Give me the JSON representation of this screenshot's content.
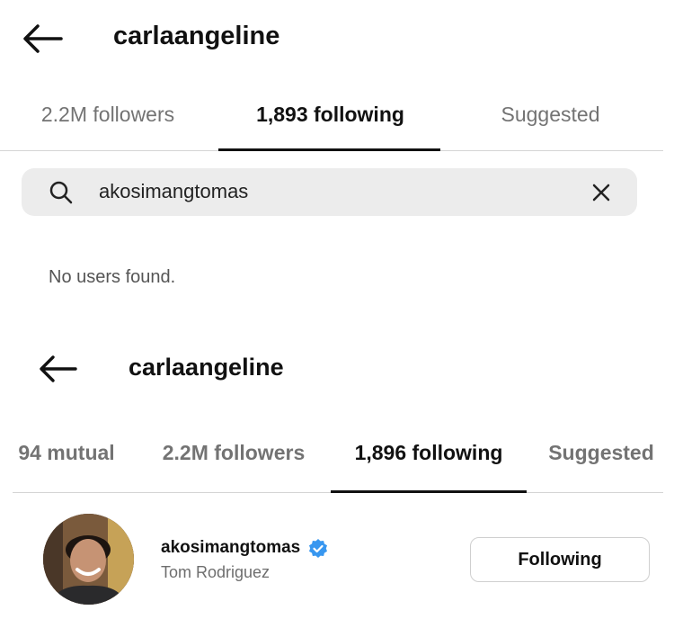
{
  "top": {
    "title": "carlaangeline",
    "tabs": [
      {
        "label": "2.2M followers"
      },
      {
        "label": "1,893 following"
      },
      {
        "label": "Suggested"
      }
    ],
    "search": {
      "value": "akosimangtomas"
    },
    "empty_message": "No users found."
  },
  "bottom": {
    "title": "carlaangeline",
    "tabs": [
      {
        "label": "94 mutual"
      },
      {
        "label": "2.2M followers"
      },
      {
        "label": "1,896 following"
      },
      {
        "label": "Suggested"
      }
    ],
    "user": {
      "username": "akosimangtomas",
      "full_name": "Tom Rodriguez",
      "verified": true,
      "button_label": "Following"
    }
  },
  "colors": {
    "verified_badge": "#3897f0",
    "divider": "#d4d4d4",
    "search_bg": "#ececec"
  }
}
